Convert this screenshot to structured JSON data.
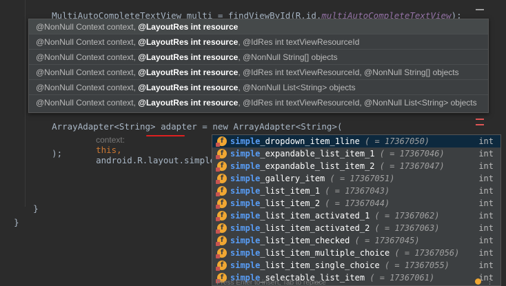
{
  "editor": {
    "line_top_1": "MultiAutoCompleteTextView multi = findViewById(R.id.",
    "line_top_2": "multiAutoCompleteTextView",
    "line_top_3": ");",
    "line_adapter": "ArrayAdapter<String> adapter = new ArrayAdapter<String>(",
    "hint_label": "context:",
    "arg_this": "this,",
    "arg_android": "android",
    "arg_rest": ".R.layout.simple",
    "close_paren": ");",
    "brace1": "}",
    "brace2": "}"
  },
  "param_info": {
    "rows": [
      {
        "pre": "@NonNull Context context, ",
        "bold": "@LayoutRes int resource",
        "post": ""
      },
      {
        "pre": "@NonNull Context context, ",
        "bold": "@LayoutRes int resource",
        "post": ", @IdRes int textViewResourceId"
      },
      {
        "pre": "@NonNull Context context, ",
        "bold": "@LayoutRes int resource",
        "post": ", @NonNull String[] objects"
      },
      {
        "pre": "@NonNull Context context, ",
        "bold": "@LayoutRes int resource",
        "post": ", @IdRes int textViewResourceId, @NonNull String[] objects"
      },
      {
        "pre": "@NonNull Context context, ",
        "bold": "@LayoutRes int resource",
        "post": ", @NonNull List<String> objects"
      },
      {
        "pre": "@NonNull Context context, ",
        "bold": "@LayoutRes int resource",
        "post": ", @IdRes int textViewResourceId, @NonNull List<String> objects"
      }
    ]
  },
  "completion": {
    "items": [
      {
        "match": "simple",
        "rest": "_dropdown_item_1line",
        "value": "( = 17367050)",
        "type": "int"
      },
      {
        "match": "simple",
        "rest": "_expandable_list_item_1",
        "value": "( = 17367046)",
        "type": "int"
      },
      {
        "match": "simple",
        "rest": "_expandable_list_item_2",
        "value": "( = 17367047)",
        "type": "int"
      },
      {
        "match": "simple",
        "rest": "_gallery_item",
        "value": "( = 17367051)",
        "type": "int"
      },
      {
        "match": "simple",
        "rest": "_list_item_1",
        "value": "( = 17367043)",
        "type": "int"
      },
      {
        "match": "simple",
        "rest": "_list_item_2",
        "value": "( = 17367044)",
        "type": "int"
      },
      {
        "match": "simple",
        "rest": "_list_item_activated_1",
        "value": "( = 17367062)",
        "type": "int"
      },
      {
        "match": "simple",
        "rest": "_list_item_activated_2",
        "value": "( = 17367063)",
        "type": "int"
      },
      {
        "match": "simple",
        "rest": "_list_item_checked",
        "value": "( = 17367045)",
        "type": "int"
      },
      {
        "match": "simple",
        "rest": "_list_item_multiple_choice",
        "value": "( = 17367056)",
        "type": "int"
      },
      {
        "match": "simple",
        "rest": "_list_item_single_choice",
        "value": "( = 17367055)",
        "type": "int"
      },
      {
        "match": "simple",
        "rest": "_selectable_list_item",
        "value": "( = 17367061)",
        "type": "int"
      }
    ],
    "footer": "Press Enter to insert, Tab to replace"
  },
  "colors": {
    "background": "#2b2b2b",
    "popup_bg": "#3c3f41",
    "match": "#589df6",
    "icon": "#f0a732",
    "error_underline": "#e02020"
  },
  "icons": {
    "completion_item": "field-icon",
    "bulb": "lightbulb-icon",
    "more": "more-dots-icon"
  }
}
